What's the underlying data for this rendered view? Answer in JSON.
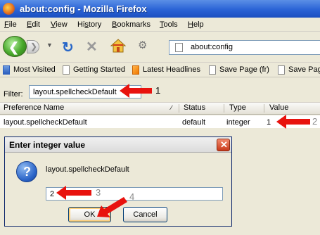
{
  "window": {
    "title": "about:config - Mozilla Firefox"
  },
  "menu": [
    {
      "pre": "",
      "u": "F",
      "post": "ile"
    },
    {
      "pre": "",
      "u": "E",
      "post": "dit"
    },
    {
      "pre": "",
      "u": "V",
      "post": "iew"
    },
    {
      "pre": "Hi",
      "u": "s",
      "post": "tory"
    },
    {
      "pre": "",
      "u": "B",
      "post": "ookmarks"
    },
    {
      "pre": "",
      "u": "T",
      "post": "ools"
    },
    {
      "pre": "",
      "u": "H",
      "post": "elp"
    }
  ],
  "url": "about:config",
  "bookmarks": [
    "Most Visited",
    "Getting Started",
    "Latest Headlines",
    "Save Page (fr)",
    "Save Pag"
  ],
  "filter": {
    "label": "Filter:",
    "value": "layout.spellcheckDefault"
  },
  "columns": [
    "Preference Name",
    "Status",
    "Type",
    "Value"
  ],
  "row": {
    "name": "layout.spellcheckDefault",
    "status": "default",
    "type": "integer",
    "value": "1"
  },
  "dialog": {
    "title": "Enter integer value",
    "message": "layout.spellcheckDefault",
    "input_value": "2",
    "ok": "OK",
    "cancel": "Cancel"
  },
  "annotations": [
    "1",
    "2",
    "3",
    "4"
  ],
  "colors": {
    "arrow": "#e8130e",
    "titlebar": "#2a63d6",
    "chrome": "#ece9d8"
  }
}
